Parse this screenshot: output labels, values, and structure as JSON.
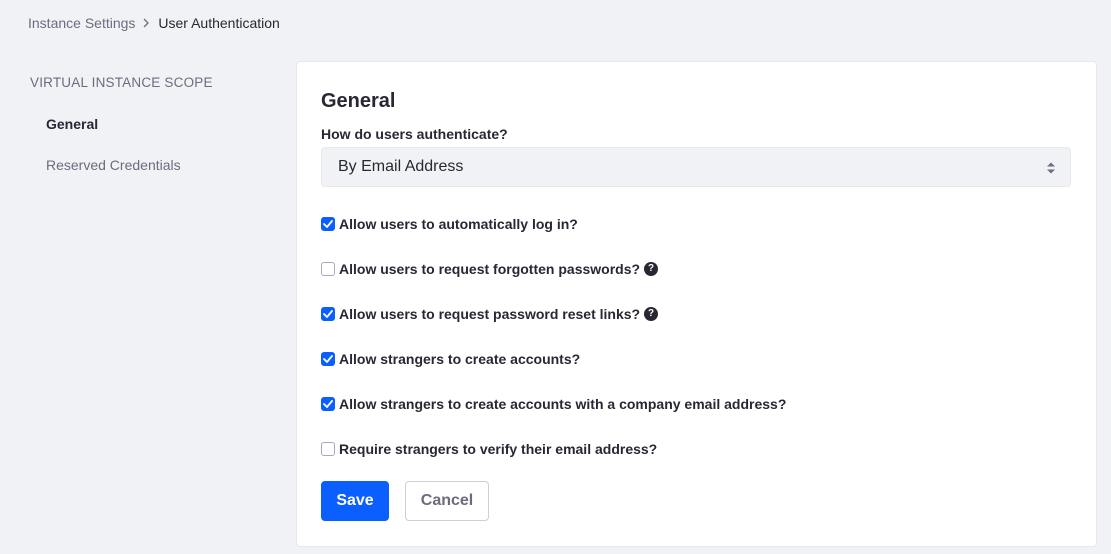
{
  "breadcrumb": {
    "parent": "Instance Settings",
    "current": "User Authentication"
  },
  "side_nav": {
    "header": "VIRTUAL INSTANCE SCOPE",
    "items": [
      {
        "label": "General",
        "active": true
      },
      {
        "label": "Reserved Credentials",
        "active": false
      }
    ]
  },
  "form": {
    "title": "General",
    "auth_label": "How do users authenticate?",
    "auth_selected": "By Email Address",
    "options": [
      {
        "label": "Allow users to automatically log in?",
        "checked": true,
        "help": false
      },
      {
        "label": "Allow users to request forgotten passwords?",
        "checked": false,
        "help": true
      },
      {
        "label": "Allow users to request password reset links?",
        "checked": true,
        "help": true
      },
      {
        "label": "Allow strangers to create accounts?",
        "checked": true,
        "help": false
      },
      {
        "label": "Allow strangers to create accounts with a company email address?",
        "checked": true,
        "help": false
      },
      {
        "label": "Require strangers to verify their email address?",
        "checked": false,
        "help": false
      }
    ],
    "help_glyph": "?",
    "save_label": "Save",
    "cancel_label": "Cancel"
  },
  "colors": {
    "primary": "#0b5fff",
    "background": "#f1f2f5",
    "text": "#272833",
    "muted": "#6b6c7e"
  },
  "icons": {
    "breadcrumb_separator": "chevron-right-icon",
    "select_arrows": "caret-double-icon",
    "check": "check-icon",
    "help": "question-circle-icon"
  }
}
